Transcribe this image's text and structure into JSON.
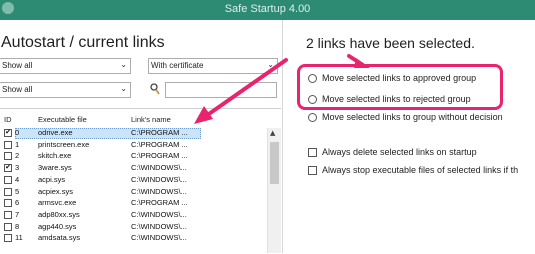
{
  "window": {
    "title": "Safe Startup 4.00"
  },
  "left": {
    "heading": "Autostart / current links",
    "filter1": "Show all",
    "filter2": "With certificate",
    "filter3": "Show all",
    "search_value": "",
    "columns": {
      "id": "ID",
      "file": "Executable file",
      "link": "Link's name"
    },
    "rows": [
      {
        "id": "0",
        "file": "odrive.exe",
        "link": "C:\\PROGRAM ...",
        "checked": true,
        "selected": true
      },
      {
        "id": "1",
        "file": "printscreen.exe",
        "link": "C:\\PROGRAM ...",
        "checked": false,
        "selected": false
      },
      {
        "id": "2",
        "file": "skitch.exe",
        "link": "C:\\PROGRAM ...",
        "checked": false,
        "selected": false
      },
      {
        "id": "3",
        "file": "3ware.sys",
        "link": "C:\\WINDOWS\\...",
        "checked": true,
        "selected": false
      },
      {
        "id": "4",
        "file": "acpi.sys",
        "link": "C:\\WINDOWS\\...",
        "checked": false,
        "selected": false
      },
      {
        "id": "5",
        "file": "acpiex.sys",
        "link": "C:\\WINDOWS\\...",
        "checked": false,
        "selected": false
      },
      {
        "id": "6",
        "file": "armsvc.exe",
        "link": "C:\\PROGRAM ...",
        "checked": false,
        "selected": false
      },
      {
        "id": "7",
        "file": "adp80xx.sys",
        "link": "C:\\WINDOWS\\...",
        "checked": false,
        "selected": false
      },
      {
        "id": "8",
        "file": "agp440.sys",
        "link": "C:\\WINDOWS\\...",
        "checked": false,
        "selected": false
      },
      {
        "id": "11",
        "file": "amdsata.sys",
        "link": "C:\\WINDOWS\\...",
        "checked": false,
        "selected": false
      }
    ]
  },
  "right": {
    "status": "2 links have been selected.",
    "options": [
      "Move selected links to approved group",
      "Move selected links to rejected group",
      "Move selected links to group without decision"
    ],
    "checks": [
      "Always delete selected links on startup",
      "Always stop executable files of selected links if th"
    ]
  },
  "colors": {
    "titlebar": "#2e8b73",
    "annotation": "#e8246e",
    "selection": "#cce4f7"
  }
}
